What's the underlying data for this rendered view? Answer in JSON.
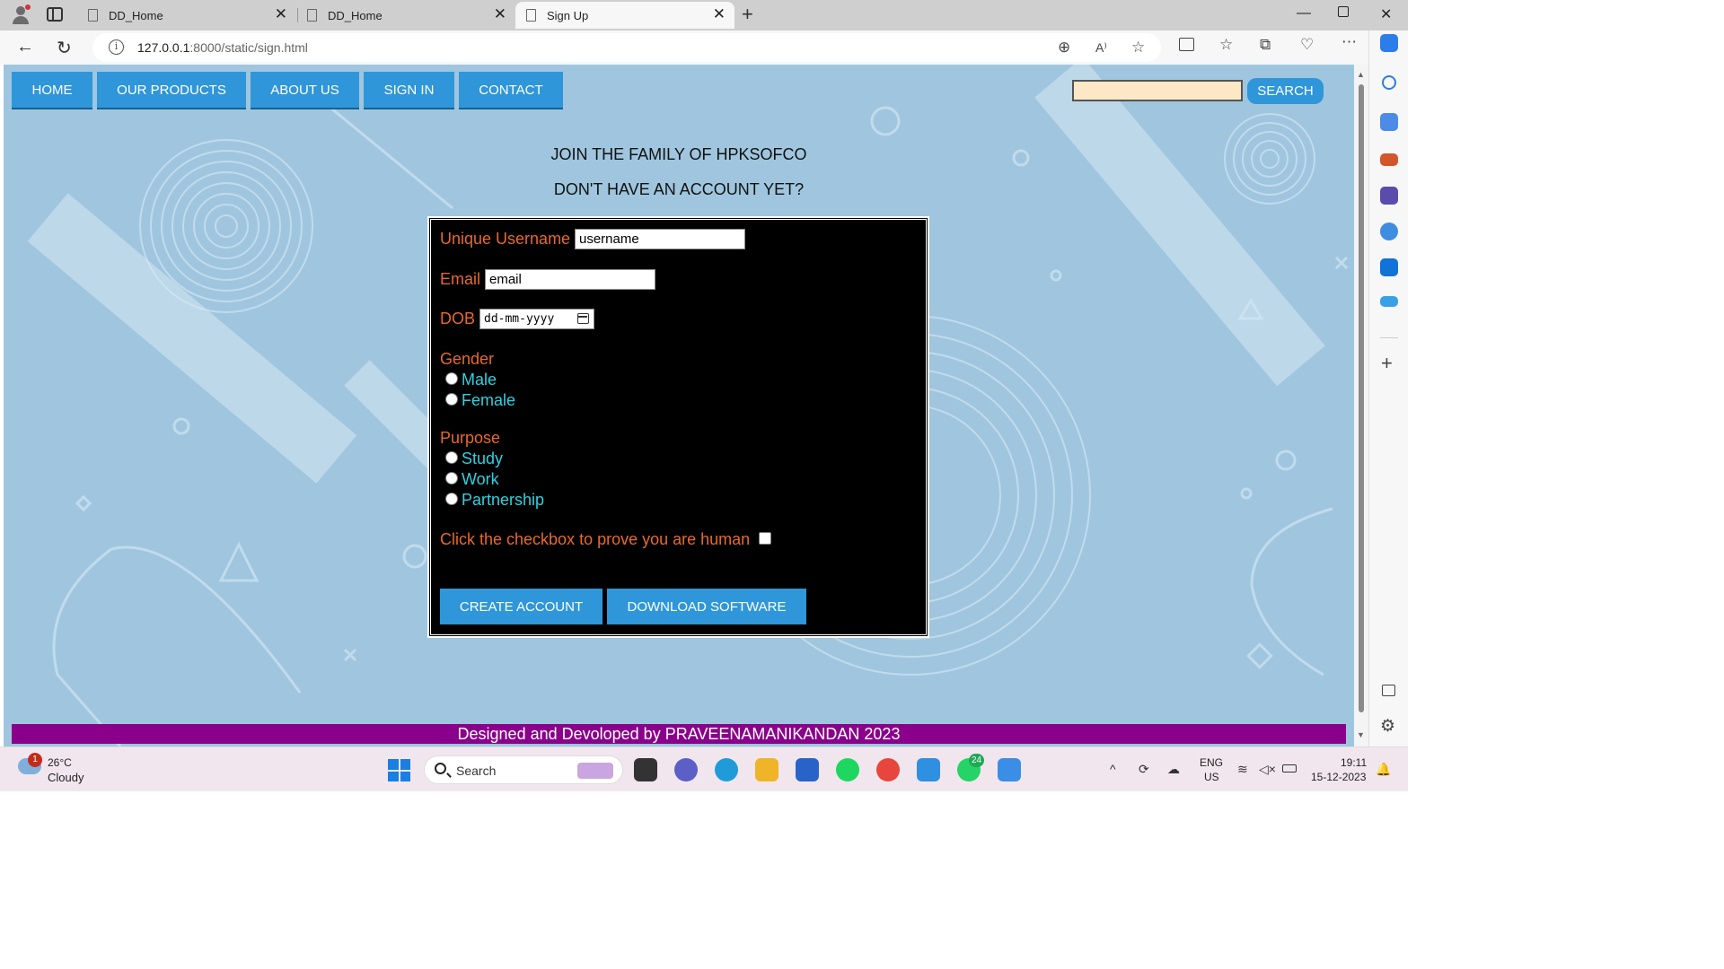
{
  "browser": {
    "tabs": [
      {
        "title": "DD_Home",
        "active": false
      },
      {
        "title": "DD_Home",
        "active": false
      },
      {
        "title": "Sign Up",
        "active": true
      }
    ],
    "url_host": "127.0.0.1",
    "url_rest": ":8000/static/sign.html"
  },
  "nav": {
    "items": [
      "HOME",
      "OUR PRODUCTS",
      "ABOUT US",
      "SIGN IN",
      "CONTACT"
    ],
    "search_value": "",
    "search_button": "SEARCH"
  },
  "page": {
    "heading": "JOIN THE FAMILY OF HPKSOFCO",
    "subheading": "DON'T HAVE AN ACCOUNT YET?"
  },
  "form": {
    "username_label": "Unique Username",
    "username_value": "username",
    "email_label": "Email",
    "email_value": "email",
    "dob_label": "DOB",
    "dob_placeholder": "dd-mm-yyyy",
    "gender_label": "Gender",
    "gender_options": [
      "Male",
      "Female"
    ],
    "purpose_label": "Purpose",
    "purpose_options": [
      "Study",
      "Work",
      "Partnership"
    ],
    "human_label": "Click the checkbox to prove you are human",
    "create_button": "CREATE ACCOUNT",
    "download_button": "DOWNLOAD SOFTWARE"
  },
  "footer": {
    "text": "Designed and Devoloped by PRAVEENAMANIKANDAN 2023"
  },
  "taskbar": {
    "weather_temp": "26°C",
    "weather_desc": "Cloudy",
    "weather_badge": "1",
    "search_label": "Search",
    "whatsapp_badge": "24",
    "lang": "ENG",
    "region": "US",
    "time": "19:11",
    "date": "15-12-2023"
  },
  "colors": {
    "page_bg": "#9fc6de",
    "nav_button": "#2f96d9",
    "label_orange": "#e8692b",
    "option_cyan": "#2fd2e0",
    "footer_purple": "#8b008b"
  }
}
